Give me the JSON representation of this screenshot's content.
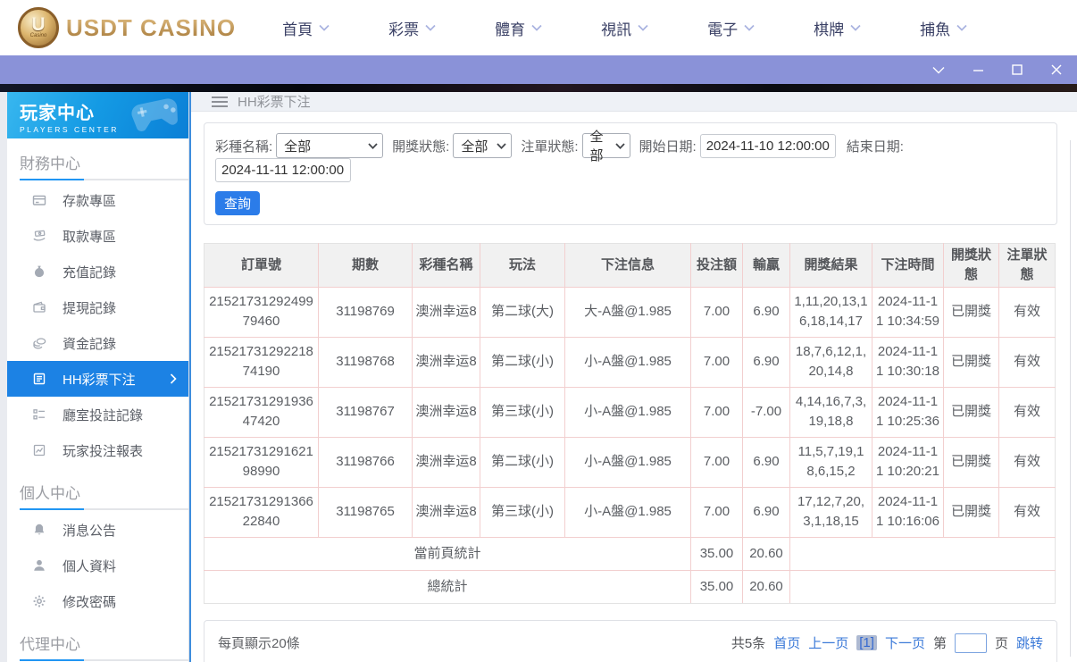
{
  "header": {
    "logo_text": "USDT CASINO",
    "logo_monogram": "U",
    "logo_small": "Casino",
    "nav": [
      {
        "label": "首頁"
      },
      {
        "label": "彩票"
      },
      {
        "label": "體育"
      },
      {
        "label": "視訊"
      },
      {
        "label": "電子"
      },
      {
        "label": "棋牌"
      },
      {
        "label": "捕魚"
      }
    ]
  },
  "sidebar": {
    "title": "玩家中心",
    "subtitle": "PLAYERS CENTER",
    "sections": [
      {
        "title": "財務中心",
        "items": [
          {
            "label": "存款專區",
            "icon": "bank-card-icon",
            "active": false
          },
          {
            "label": "取款專區",
            "icon": "hand-money-icon",
            "active": false
          },
          {
            "label": "充值記錄",
            "icon": "money-bag-icon",
            "active": false
          },
          {
            "label": "提現記錄",
            "icon": "wallet-icon",
            "active": false
          },
          {
            "label": "資金記錄",
            "icon": "coins-icon",
            "active": false
          },
          {
            "label": "HH彩票下注",
            "icon": "ledger-icon",
            "active": true
          },
          {
            "label": "廳室投註記錄",
            "icon": "list-icon",
            "active": false
          },
          {
            "label": "玩家投注報表",
            "icon": "report-chart-icon",
            "active": false
          }
        ]
      },
      {
        "title": "個人中心",
        "items": [
          {
            "label": "消息公告",
            "icon": "bell-icon",
            "active": false
          },
          {
            "label": "個人資料",
            "icon": "person-icon",
            "active": false
          },
          {
            "label": "修改密碼",
            "icon": "gear-icon",
            "active": false
          }
        ]
      },
      {
        "title": "代理中心",
        "items": []
      }
    ]
  },
  "breadcrumb": {
    "title": "HH彩票下注"
  },
  "filters": {
    "lottery_label": "彩種名稱:",
    "lottery_value": "全部",
    "draw_status_label": "開獎狀態:",
    "draw_status_value": "全部",
    "order_status_label": "注單狀態:",
    "order_status_value": "全部",
    "start_label": "開始日期:",
    "start_value": "2024-11-10 12:00:00",
    "end_label": "結束日期:",
    "end_value": "2024-11-11 12:00:00",
    "query_button": "查詢"
  },
  "table": {
    "headers": [
      "訂單號",
      "期數",
      "彩種名稱",
      "玩法",
      "下注信息",
      "投注額",
      "輸贏",
      "開獎結果",
      "下注時間",
      "開獎狀態",
      "注單狀態"
    ],
    "rows": [
      [
        "2152173129249979460",
        "31198769",
        "澳洲幸运8",
        "第二球(大)",
        "大-A盤@1.985",
        "7.00",
        "6.90",
        "1,11,20,13,16,18,14,17",
        "2024-11-11 10:34:59",
        "已開獎",
        "有效"
      ],
      [
        "2152173129221874190",
        "31198768",
        "澳洲幸运8",
        "第二球(小)",
        "小-A盤@1.985",
        "7.00",
        "6.90",
        "18,7,6,12,1,20,14,8",
        "2024-11-11 10:30:18",
        "已開獎",
        "有效"
      ],
      [
        "2152173129193647420",
        "31198767",
        "澳洲幸运8",
        "第三球(小)",
        "小-A盤@1.985",
        "7.00",
        "-7.00",
        "4,14,16,7,3,19,18,8",
        "2024-11-11 10:25:36",
        "已開獎",
        "有效"
      ],
      [
        "2152173129162198990",
        "31198766",
        "澳洲幸运8",
        "第二球(小)",
        "小-A盤@1.985",
        "7.00",
        "6.90",
        "11,5,7,19,18,6,15,2",
        "2024-11-11 10:20:21",
        "已開獎",
        "有效"
      ],
      [
        "2152173129136622840",
        "31198765",
        "澳洲幸运8",
        "第三球(小)",
        "小-A盤@1.985",
        "7.00",
        "6.90",
        "17,12,7,20,3,1,18,15",
        "2024-11-11 10:16:06",
        "已開獎",
        "有效"
      ]
    ],
    "summary": [
      {
        "label": "當前頁統計",
        "bet": "35.00",
        "winloss": "20.60"
      },
      {
        "label": "總統計",
        "bet": "35.00",
        "winloss": "20.60"
      }
    ]
  },
  "footer": {
    "page_size_text": "每頁顯示20條",
    "total_text": "共5条",
    "first": "首页",
    "prev": "上一页",
    "current_page": "[1]",
    "next": "下一页",
    "jump_prefix": "第",
    "jump_suffix": "页",
    "jump_action": "跳转"
  },
  "colors": {
    "accent_blue": "#1c82e4",
    "titlebar_purple": "#8a92d8",
    "link_blue": "#3a79d8",
    "table_border_pink": "#f2cfcf",
    "brand_gold": "#b9935a"
  }
}
